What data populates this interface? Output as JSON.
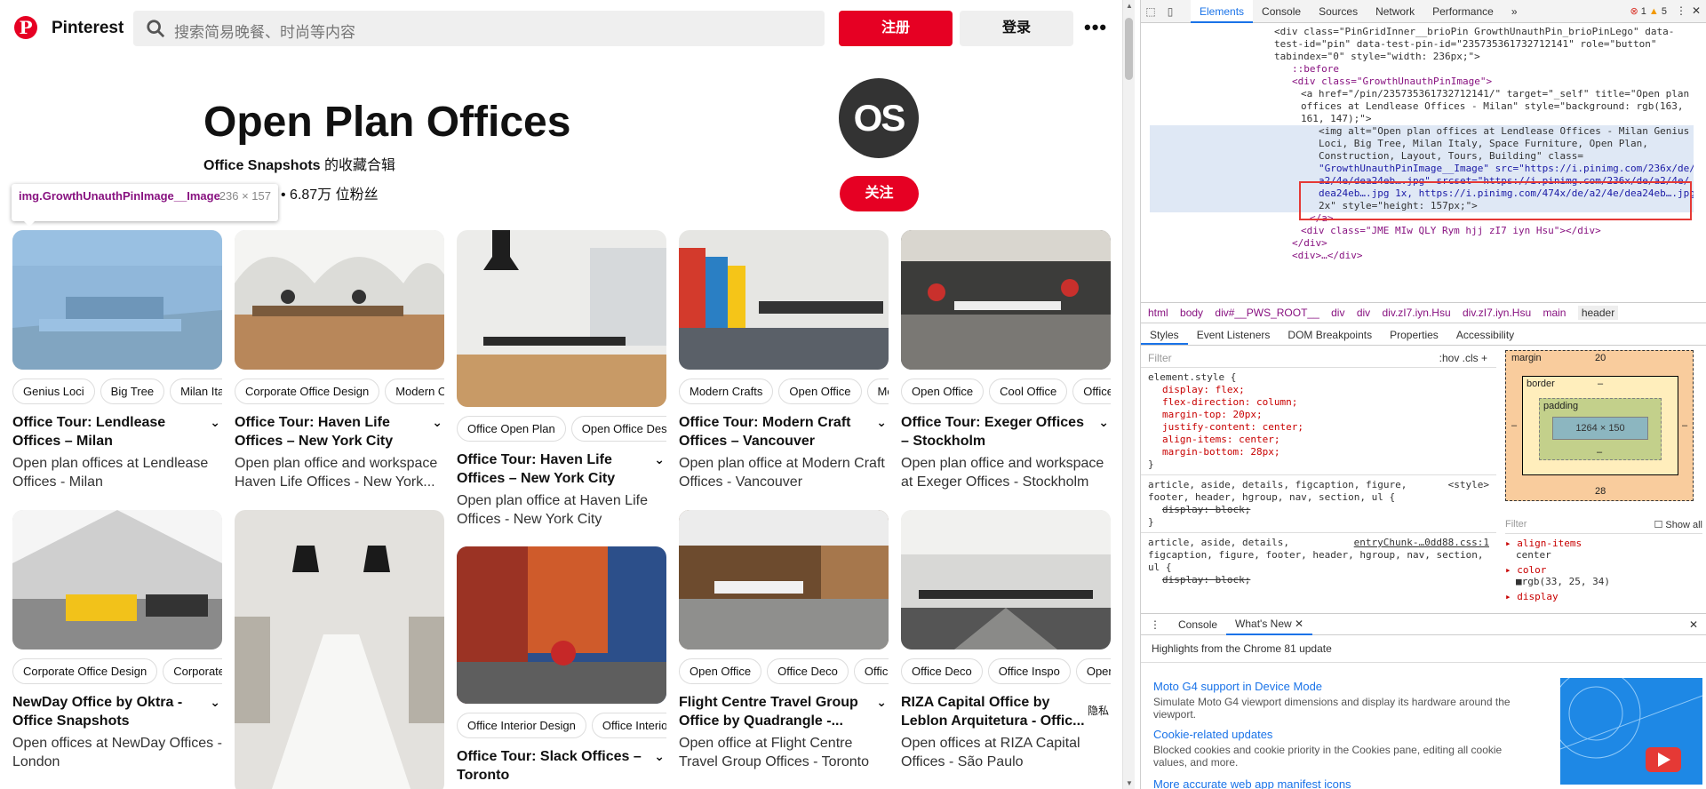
{
  "header": {
    "brand": "Pinterest",
    "search_placeholder": "搜索简易晚餐、时尚等内容",
    "signup": "注册",
    "login": "登录",
    "more": "•••"
  },
  "board": {
    "title": "Open Plan Offices",
    "owner": "Office Snapshots",
    "owner_suffix": " 的收藏合辑",
    "stats": "• 6.87万 位粉丝",
    "avatar_text": "OS",
    "follow": "关注"
  },
  "tooltip": {
    "selector": "img.GrowthUnauthPinImage__Image",
    "dims": "236 × 157"
  },
  "pins": [
    {
      "tags": [
        "Genius Loci",
        "Big Tree",
        "Milan Italy"
      ],
      "title": "Office Tour: Lendlease Offices – Milan",
      "desc": "Open plan offices at Lendlease Offices - Milan"
    },
    {
      "tags": [
        "Corporate Office Design",
        "Modern Office"
      ],
      "title": "Office Tour: Haven Life Offices – New York City",
      "desc": "Open plan office and workspace Haven Life Offices - New York..."
    },
    {
      "tags": [
        "Office Open Plan",
        "Open Office Design"
      ],
      "title": "Office Tour: Haven Life Offices – New York City",
      "desc": "Open plan office at Haven Life Offices - New York City"
    },
    {
      "tags": [
        "Modern Crafts",
        "Open Office",
        "Modern"
      ],
      "title": "Office Tour: Modern Craft Offices – Vancouver",
      "desc": "Open plan office at Modern Craft Offices - Vancouver"
    },
    {
      "tags": [
        "Open Office",
        "Cool Office",
        "Office Ideas"
      ],
      "title": "Office Tour: Exeger Offices – Stockholm",
      "desc": "Open plan office and workspace at Exeger Offices - Stockholm"
    },
    {
      "tags": [
        "Corporate Office Design",
        "Corporate Interiors"
      ],
      "title": "NewDay Office by Oktra - Office Snapshots",
      "desc": "Open offices at NewDay Offices - London"
    },
    {
      "tags": [],
      "title": "",
      "desc": ""
    },
    {
      "tags": [
        "Office Interior Design",
        "Office Interiors"
      ],
      "title": "Office Tour: Slack Offices – Toronto",
      "desc": ""
    },
    {
      "tags": [
        "Open Office",
        "Office Deco",
        "Office Space"
      ],
      "title": "Flight Centre Travel Group Office by Quadrangle -...",
      "desc": "Open office at Flight Centre Travel Group Offices - Toronto"
    },
    {
      "tags": [
        "Office Deco",
        "Office Inspo",
        "Open Office"
      ],
      "title": "RIZA Capital Office by Leblon Arquitetura - Offic...",
      "desc": "Open offices at RIZA Capital Offices - São Paulo"
    }
  ],
  "privacy": "隐私",
  "devtools": {
    "tabs": [
      "Elements",
      "Console",
      "Sources",
      "Network",
      "Performance"
    ],
    "active_tab": "Elements",
    "errors": "1",
    "warnings": "5",
    "dom_lines": [
      "<div class=\"PinGridInner__brioPin GrowthUnauthPin_brioPinLego\" data-",
      "test-id=\"pin\" data-test-pin-id=\"235735361732712141\" role=\"button\"",
      "tabindex=\"0\" style=\"width: 236px;\">",
      "::before",
      "<div class=\"GrowthUnauthPinImage\">",
      "<a href=\"/pin/235735361732712141/\" target=\"_self\" title=\"Open plan",
      "offices at Lendlease Offices - Milan\" style=\"background: rgb(163,",
      "161, 147);\">",
      "<img alt=\"Open plan offices at Lendlease Offices - Milan Genius",
      "Loci, Big Tree, Milan Italy, Space Furniture, Open Plan,",
      "Construction, Layout, Tours, Building\" class=",
      "\"GrowthUnauthPinImage__Image\" src=\"https://i.pinimg.com/236x/de/",
      "a2/4e/dea24eb….jpg\" srcset=\"https://i.pinimg.com/236x/de/a2/4e/",
      "dea24eb….jpg 1x, https://i.pinimg.com/474x/de/a2/4e/dea24eb….jpg",
      "2x\" style=\"height: 157px;\">",
      "</a>",
      "<div class=\"JME MIw QLY Rym hjj zI7 iyn Hsu\"></div>",
      "</div>",
      "<div>…</div>"
    ],
    "breadcrumbs": [
      "html",
      "body",
      "div#__PWS_ROOT__",
      "div",
      "div",
      "div.zI7.iyn.Hsu",
      "div.zI7.iyn.Hsu",
      "main",
      "header"
    ],
    "subtabs": [
      "Styles",
      "Event Listeners",
      "DOM Breakpoints",
      "Properties",
      "Accessibility"
    ],
    "filter_placeholder": "Filter",
    "filter_tools": ":hov  .cls  +",
    "styles": {
      "selector": "element.style {",
      "props": [
        "display: flex;",
        "flex-direction: column;",
        "margin-top: 20px;",
        "justify-content: center;",
        "align-items: center;",
        "margin-bottom: 28px;"
      ],
      "rule2_selector": "article, aside, details, figcaption, figure, footer, header, hgroup, nav, section, ul {",
      "rule2_src": "<style>",
      "rule2_prop": "display: block;",
      "rule3_selector": "article, aside, details, figcaption, figure, footer, header, hgroup, nav, section, ul {",
      "rule3_src": "entryChunk-…0dd88.css:1",
      "rule3_prop": "display: block;"
    },
    "box_model": {
      "margin_label": "margin",
      "margin_top": "20",
      "margin_bottom": "28",
      "border_label": "border",
      "border_val": "–",
      "padding_label": "padding",
      "padding_val": "–",
      "content": "1264 × 150",
      "side": "–"
    },
    "computed": {
      "filter": "Filter",
      "show_all": "Show all",
      "p1": "align-items",
      "v1": "center",
      "p2": "color",
      "v2": "rgb(33, 25, 34)",
      "p3": "display"
    },
    "drawer": {
      "tabs": [
        "Console",
        "What's New"
      ],
      "highlight": "Highlights from the Chrome 81 update",
      "items": [
        {
          "h": "Moto G4 support in Device Mode",
          "b": "Simulate Moto G4 viewport dimensions and display its hardware around the viewport."
        },
        {
          "h": "Cookie-related updates",
          "b": "Blocked cookies and cookie priority in the Cookies pane, editing all cookie values, and more."
        },
        {
          "h": "More accurate web app manifest icons",
          "b": ""
        }
      ]
    }
  }
}
